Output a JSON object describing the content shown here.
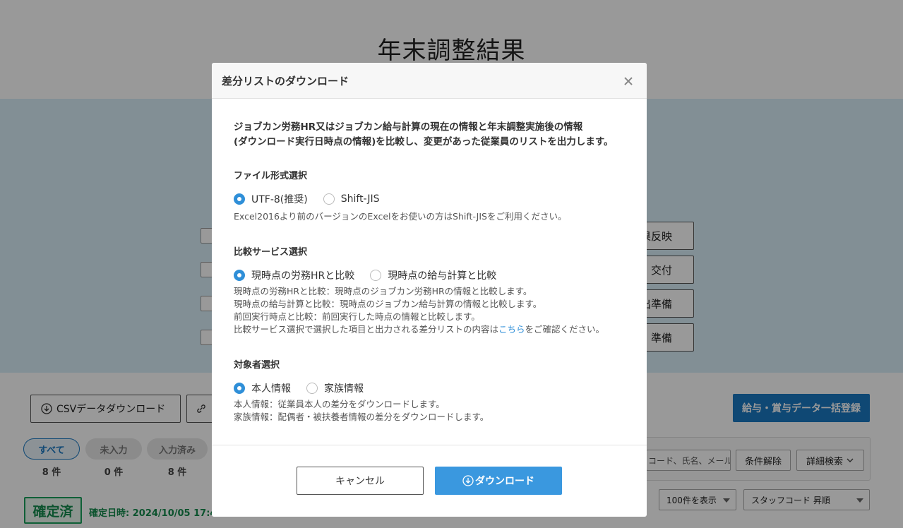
{
  "background": {
    "page_title": "年末調整結果",
    "right_buttons": [
      "果反映",
      "交付",
      "出準備",
      "準備"
    ],
    "csv_download_label": "CSVデータダウンロード",
    "bulk_register_label": "給与・賞与データ一括登録",
    "filters": [
      {
        "label": "すべて",
        "count": "8 件"
      },
      {
        "label": "未入力",
        "count": "0 件"
      },
      {
        "label": "入力済み",
        "count": "8 件"
      }
    ],
    "search_placeholder": "コード、氏名、メール",
    "clear_label": "条件解除",
    "detail_search_label": "詳細検索",
    "status_badge": "確定済",
    "confirmed_date": "確定日時: 2024/10/05 17:4",
    "per_page_label": "100件を表示",
    "sort_label": "スタッフコード 昇順"
  },
  "modal": {
    "title": "差分リストのダウンロード",
    "intro_line1": "ジョブカン労務HR又はジョブカン給与計算の現在の情報と年末調整実施後の情報",
    "intro_line2": "(ダウンロード実行日時点の情報)を比較し、変更があった従業員のリストを出力します。",
    "file_format": {
      "title": "ファイル形式選択",
      "options": [
        "UTF-8(推奨)",
        "Shift-JIS"
      ],
      "selected": 0,
      "help": "Excel2016より前のバージョンのExcelをお使いの方はShift-JISをご利用ください。"
    },
    "compare_service": {
      "title": "比較サービス選択",
      "options": [
        "現時点の労務HRと比較",
        "現時点の給与計算と比較"
      ],
      "selected": 0,
      "help1": "現時点の労務HRと比較：現時点のジョブカン労務HRの情報と比較します。",
      "help2": "現時点の給与計算と比較：現時点のジョブカン給与計算の情報と比較します。",
      "help3": "前回実行時点と比較：前回実行した時点の情報と比較します。",
      "help4_pre": "比較サービス選択で選択した項目と出力される差分リストの内容は",
      "help4_link": "こちら",
      "help4_post": "をご確認ください。"
    },
    "target": {
      "title": "対象者選択",
      "options": [
        "本人情報",
        "家族情報"
      ],
      "selected": 0,
      "help1": "本人情報：従業員本人の差分をダウンロードします。",
      "help2": "家族情報：配偶者・被扶養者情報の差分をダウンロードします。"
    },
    "cancel_label": "キャンセル",
    "download_label": "ダウンロード"
  },
  "colors": {
    "primary": "#3a98df",
    "link": "#2f8fd8",
    "confirmed": "#148a4d",
    "background_band": "#d9eef8"
  }
}
